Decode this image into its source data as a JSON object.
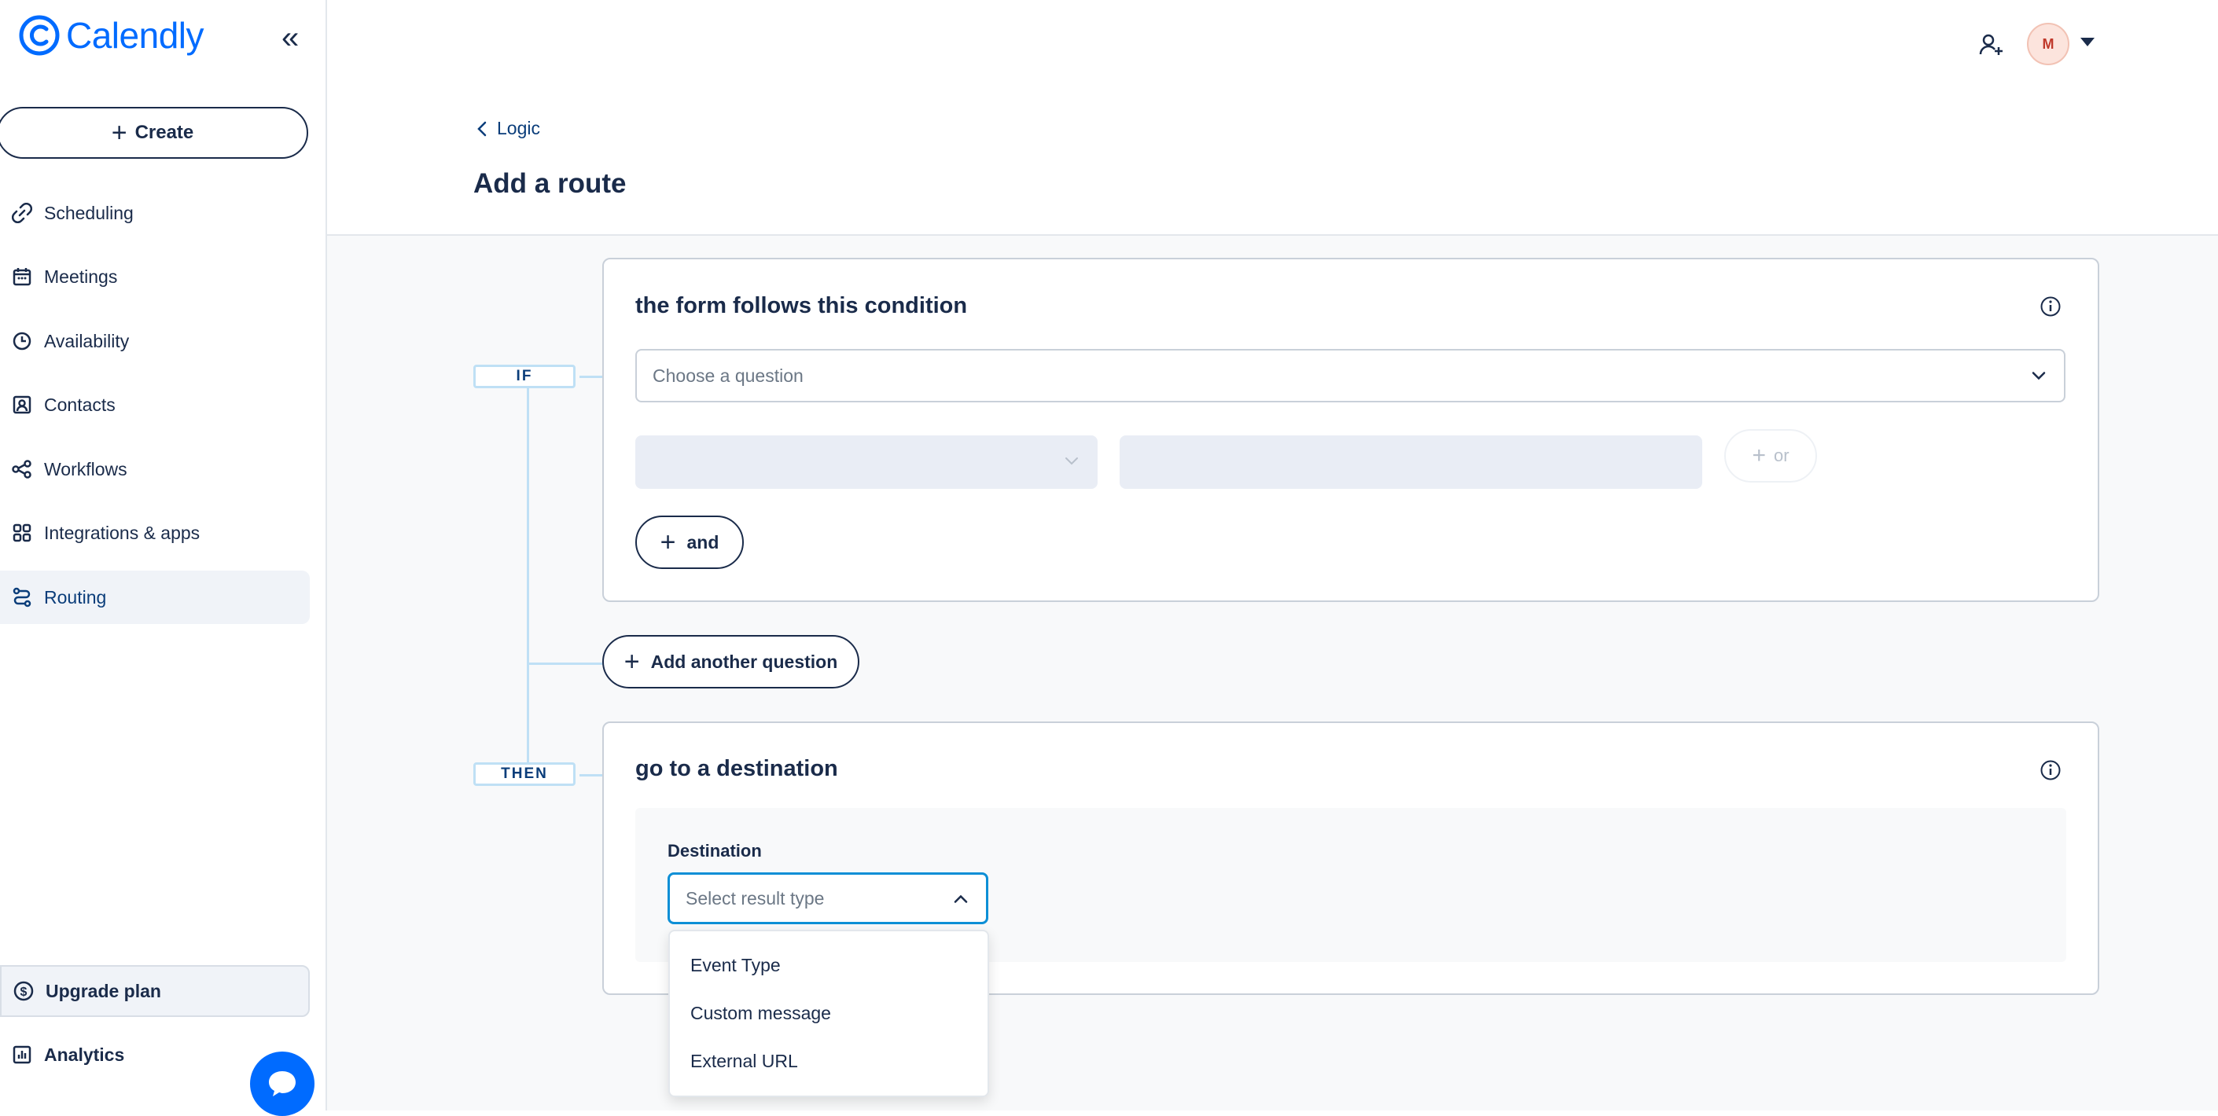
{
  "brand": {
    "name": "Calendly",
    "color": "#006bff"
  },
  "sidebar": {
    "create_label": "Create",
    "items": [
      {
        "label": "Scheduling",
        "icon": "link-icon"
      },
      {
        "label": "Meetings",
        "icon": "calendar-icon"
      },
      {
        "label": "Availability",
        "icon": "clock-icon"
      },
      {
        "label": "Contacts",
        "icon": "contact-icon"
      },
      {
        "label": "Workflows",
        "icon": "workflow-icon"
      },
      {
        "label": "Integrations & apps",
        "icon": "grid-icon"
      },
      {
        "label": "Routing",
        "icon": "routing-icon",
        "active": true
      }
    ],
    "upgrade_label": "Upgrade plan",
    "analytics_label": "Analytics"
  },
  "header": {
    "back_label": "Logic",
    "title": "Add a route",
    "avatar_initial": "M"
  },
  "route": {
    "if_tag": "IF",
    "then_tag": "THEN",
    "condition": {
      "title": "the form follows this condition",
      "question_placeholder": "Choose a question",
      "or_label": "or",
      "and_label": "and"
    },
    "add_question_label": "Add another question",
    "destination": {
      "title": "go to a destination",
      "label": "Destination",
      "placeholder": "Select result type",
      "options": [
        "Event Type",
        "Custom message",
        "External URL"
      ]
    }
  }
}
